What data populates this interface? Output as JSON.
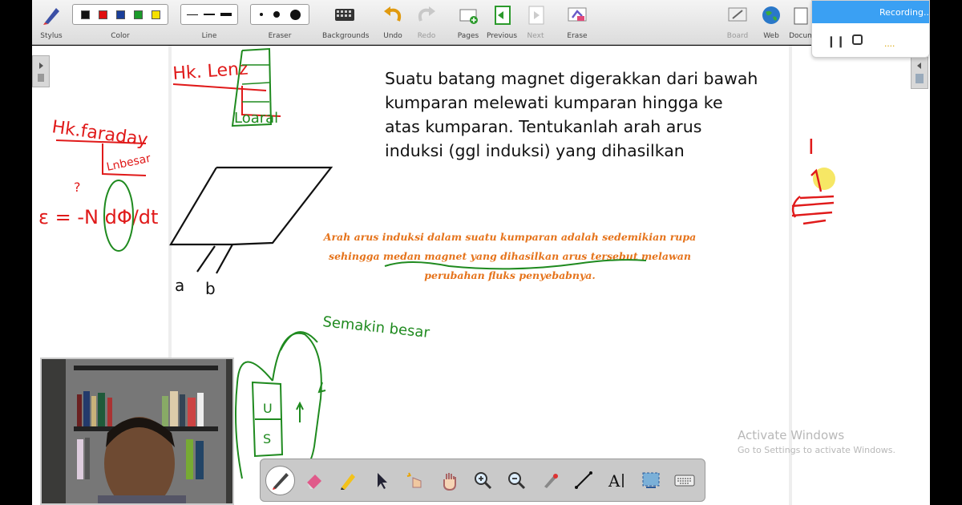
{
  "toolbar": {
    "stylus": "Stylus",
    "color": "Color",
    "line": "Line",
    "eraser": "Eraser",
    "backgrounds": "Backgrounds",
    "undo": "Undo",
    "redo": "Redo",
    "pages": "Pages",
    "previous": "Previous",
    "next": "Next",
    "erase": "Erase",
    "board": "Board",
    "web": "Web",
    "documents": "Docum",
    "colors": [
      "#111111",
      "#e01010",
      "#1a3f9a",
      "#1b9a2a",
      "#f5e000"
    ]
  },
  "recording": {
    "status": "Recording..."
  },
  "question": "Suatu batang magnet digerakkan dari bawah kumparan melewati kumparan hingga  ke atas kumparan. Tentukanlah arah  arus induksi (ggl induksi) yang dihasilkan",
  "rule": {
    "line1": "Arah arus induksi dalam suatu kumparan adalah sedemikian rupa",
    "line2": "sehingga medan magnet yang dihasilkan arus tersebut melawan",
    "line3": "perubahan fluks penyebabnya."
  },
  "handwriting": {
    "lenz": "Hk. Lenz",
    "lenz_sub": "Loaral",
    "faraday": "Hk.faraday",
    "besar": "Lnbesar",
    "formula": "ε = -N dΦ/dt",
    "a": "a",
    "b": "b",
    "semakin": "Semakin besar",
    "magnet_u": "U",
    "magnet_s": "S",
    "current": "I",
    "ink_colors": {
      "red": "#e01a1a",
      "green": "#1f8a1f",
      "black": "#111111"
    }
  },
  "watermark": {
    "title": "Activate Windows",
    "subtitle": "Go to Settings to activate Windows."
  }
}
